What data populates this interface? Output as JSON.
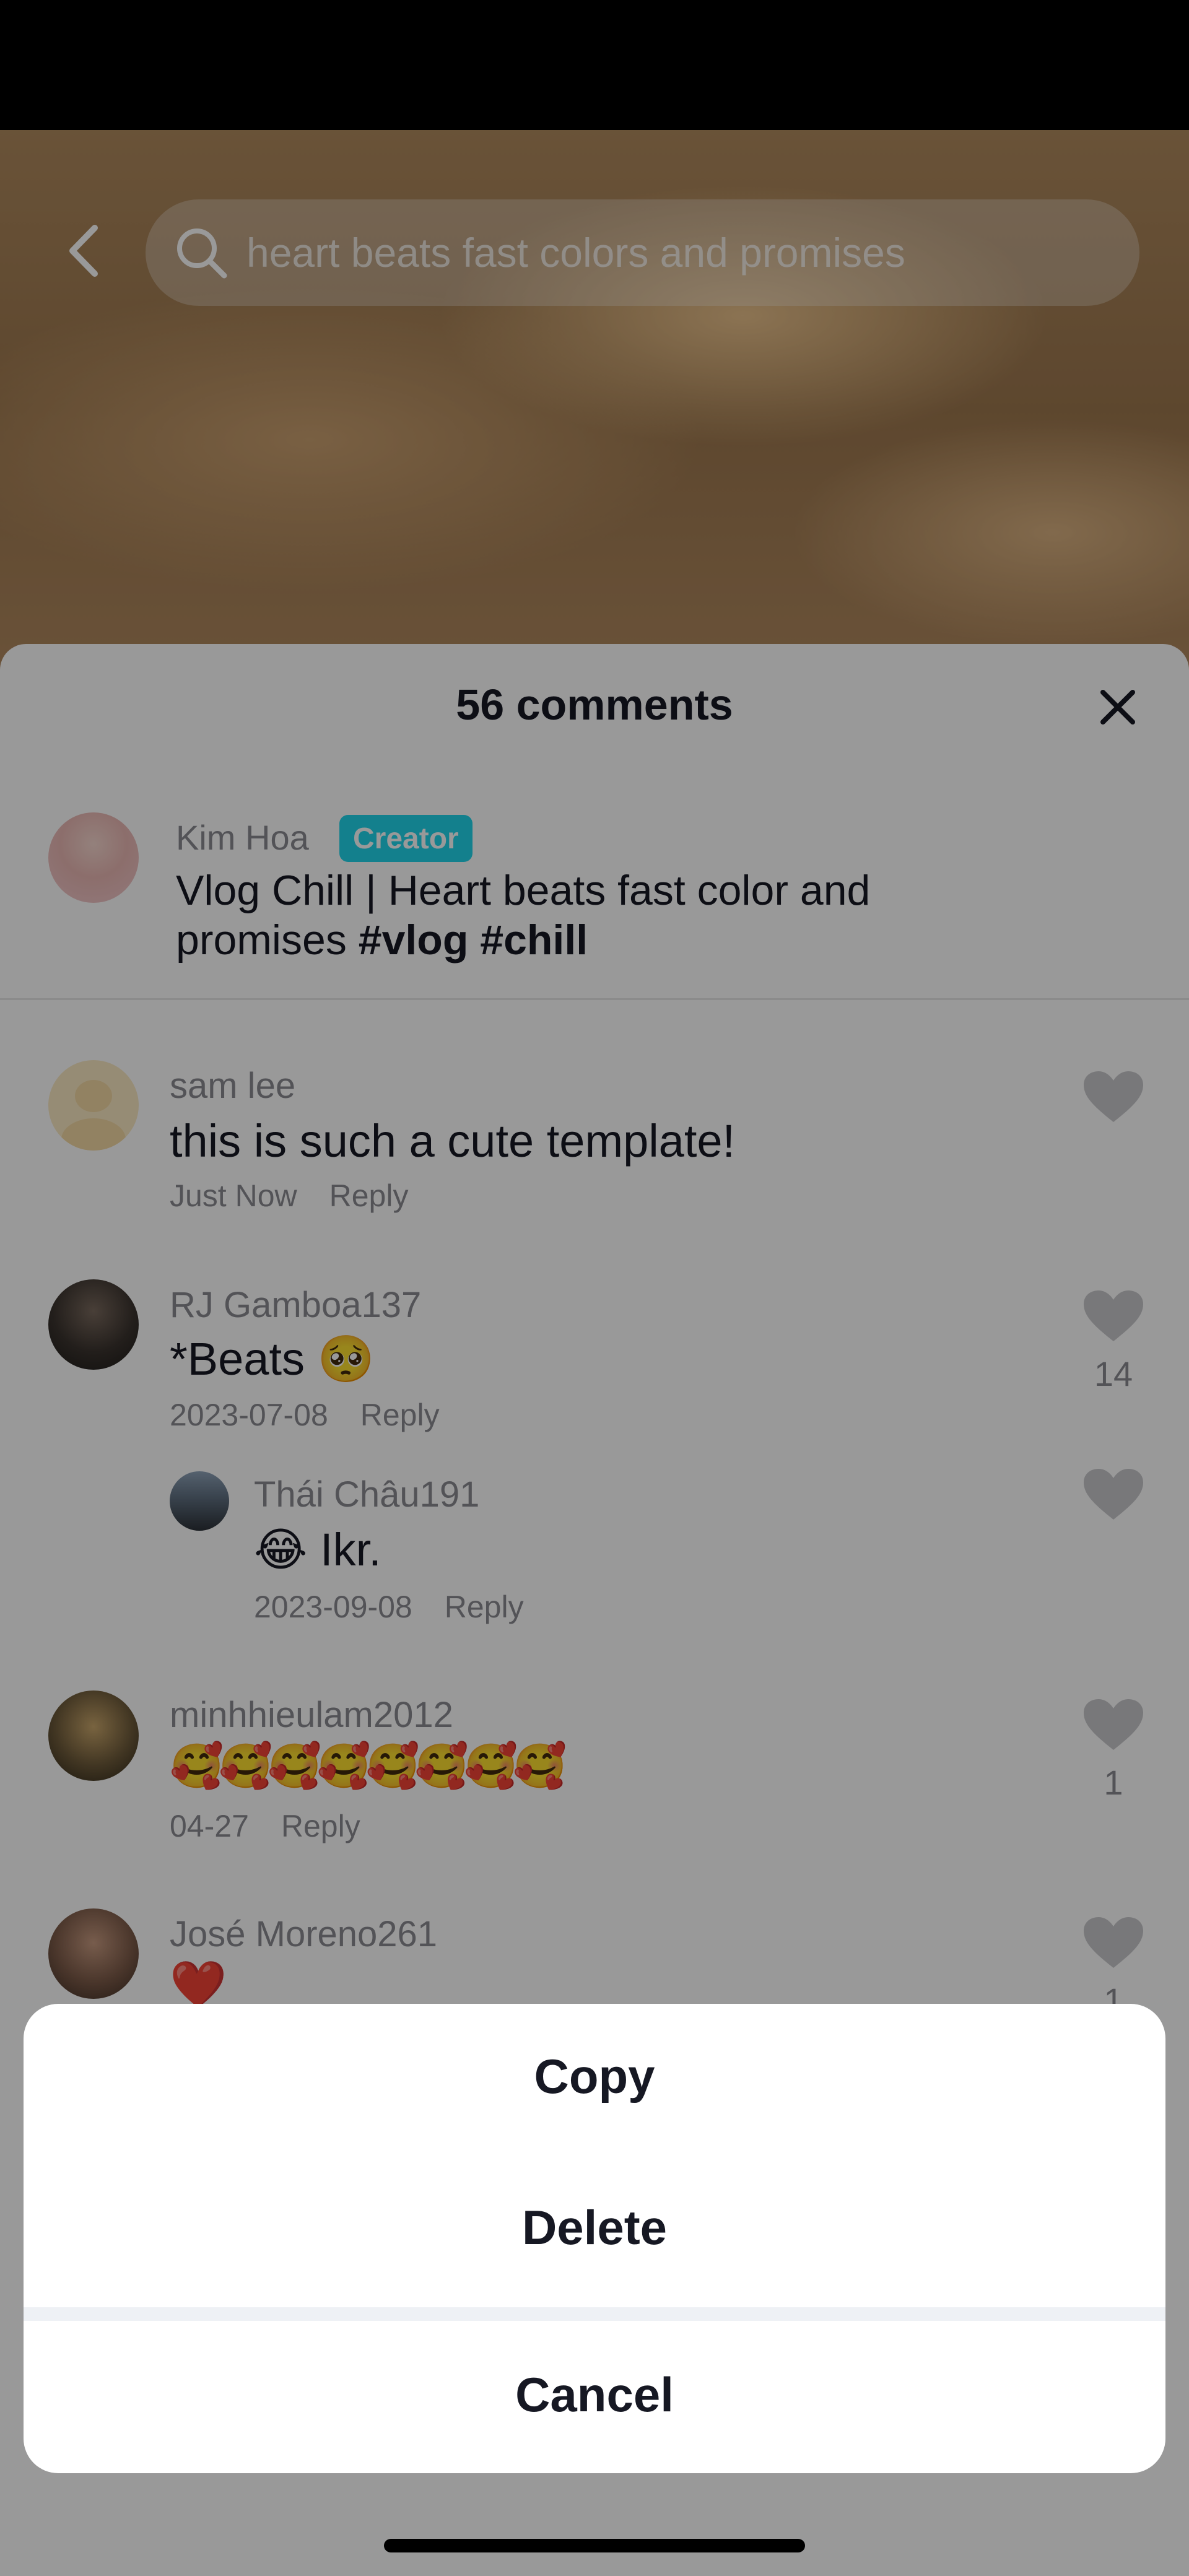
{
  "search": {
    "query": "heart beats fast colors and promises"
  },
  "sheet": {
    "title": "56 comments"
  },
  "creator": {
    "name": "Kim Hoa",
    "badge": "Creator",
    "caption_text": "Vlog Chill | Heart beats fast color and promises",
    "hashtags": "#vlog #chill"
  },
  "comments": [
    {
      "name": "sam lee",
      "text": "this is such a cute template!",
      "time": "Just Now",
      "reply": "Reply",
      "likes": ""
    },
    {
      "name": "RJ Gamboa137",
      "text": "*Beats 🥺",
      "time": "2023-07-08",
      "reply": "Reply",
      "likes": "14"
    },
    {
      "name": "Thái Châu191",
      "text": "😂 Ikr.",
      "time": "2023-09-08",
      "reply": "Reply",
      "likes": ""
    },
    {
      "name": "minhhieulam2012",
      "text": "🥰🥰🥰🥰🥰🥰🥰🥰",
      "time": "04-27",
      "reply": "Reply",
      "likes": "1"
    },
    {
      "name": "José Moreno261",
      "text": "❤️",
      "time": "",
      "reply": "",
      "likes": "1"
    }
  ],
  "actions": {
    "copy": "Copy",
    "delete": "Delete",
    "cancel": "Cancel"
  },
  "colors": {
    "creator_badge": "#20d5ec",
    "text_primary": "#161823",
    "text_secondary": "#8a8b91",
    "heart": "#c8c8cc"
  },
  "icons": [
    "back-arrow-icon",
    "search-icon",
    "close-icon",
    "heart-icon"
  ]
}
